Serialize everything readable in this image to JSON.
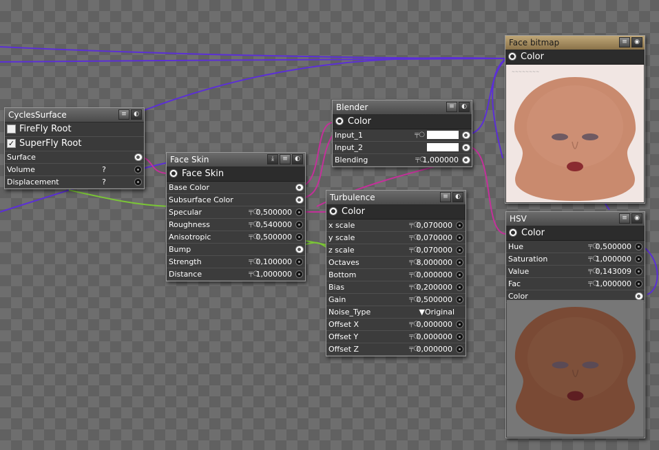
{
  "colors": {
    "wire_purple": "#5b2fd6",
    "wire_magenta": "#c4309a",
    "wire_green": "#7bc636",
    "gold_title": "#bfa778"
  },
  "nodes": {
    "cycles_surface": {
      "title": "CyclesSurface",
      "checks": [
        {
          "label": "FireFly Root",
          "checked": false
        },
        {
          "label": "SuperFly Root",
          "checked": true
        }
      ],
      "rows": [
        {
          "label": "Surface",
          "extra": ""
        },
        {
          "label": "Volume",
          "extra": "?"
        },
        {
          "label": "Displacement",
          "extra": "?"
        }
      ]
    },
    "face_skin": {
      "title": "Face Skin",
      "header": "Face Skin",
      "rows": [
        {
          "label": "Base Color",
          "value": ""
        },
        {
          "label": "Subsurface Color",
          "value": ""
        },
        {
          "label": "Specular",
          "value": "0,500000"
        },
        {
          "label": "Roughness",
          "value": "0,540000"
        },
        {
          "label": "Anisotropic",
          "value": "0,500000"
        },
        {
          "label": "Bump",
          "value": ""
        },
        {
          "label": "Strength",
          "value": "0,100000"
        },
        {
          "label": "Distance",
          "value": "1,000000"
        }
      ]
    },
    "blender": {
      "title": "Blender",
      "header": "Color",
      "rows": [
        {
          "label": "Input_1",
          "value": ""
        },
        {
          "label": "Input_2",
          "value": ""
        },
        {
          "label": "Blending",
          "value": "1,000000"
        }
      ]
    },
    "turbulence": {
      "title": "Turbulence",
      "header": "Color",
      "rows": [
        {
          "label": "x scale",
          "value": "0,070000"
        },
        {
          "label": "y scale",
          "value": "0,070000"
        },
        {
          "label": "z scale",
          "value": "0,070000"
        },
        {
          "label": "Octaves",
          "value": "8,000000"
        },
        {
          "label": "Bottom",
          "value": "0,000000"
        },
        {
          "label": "Bias",
          "value": "0,200000"
        },
        {
          "label": "Gain",
          "value": "0,500000"
        },
        {
          "label": "Noise_Type",
          "value": "Original"
        },
        {
          "label": "Offset X",
          "value": "0,000000"
        },
        {
          "label": "Offset Y",
          "value": "0,000000"
        },
        {
          "label": "Offset Z",
          "value": "0,000000"
        }
      ]
    },
    "face_bitmap": {
      "title": "Face bitmap",
      "header": "Color"
    },
    "hsv": {
      "title": "HSV",
      "header": "Color",
      "rows": [
        {
          "label": "Hue",
          "value": "0,500000"
        },
        {
          "label": "Saturation",
          "value": "1,000000"
        },
        {
          "label": "Value",
          "value": "0,143009"
        },
        {
          "label": "Fac",
          "value": "1,000000"
        },
        {
          "label": "Color",
          "value": ""
        }
      ]
    }
  }
}
